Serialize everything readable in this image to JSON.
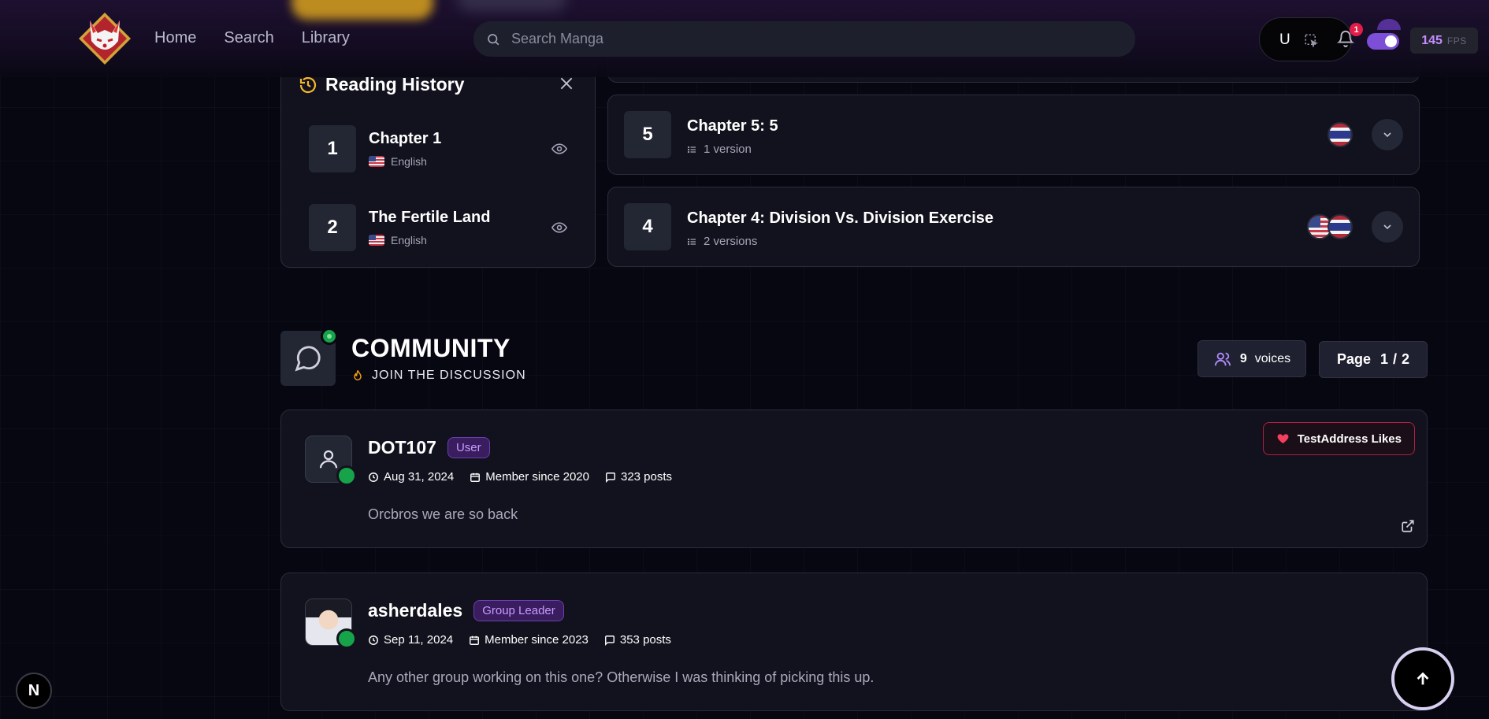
{
  "header": {
    "nav": [
      "Home",
      "Search",
      "Library"
    ],
    "search_placeholder": "Search Manga",
    "toolbar_letter": "U",
    "notification_count": "1",
    "fps_value": "145",
    "fps_label": "FPS"
  },
  "history": {
    "title": "Reading History",
    "items": [
      {
        "number": "1",
        "title": "Chapter 1",
        "language": "English"
      },
      {
        "number": "2",
        "title": "The Fertile Land",
        "language": "English"
      }
    ]
  },
  "chapters": [
    {
      "number": "5",
      "title": "Chapter 5: 5",
      "versions": "1 version"
    },
    {
      "number": "4",
      "title": "Chapter 4: Division Vs. Division Exercise",
      "versions": "2 versions"
    }
  ],
  "community": {
    "title": "COMMUNITY",
    "subtitle": "JOIN THE DISCUSSION",
    "voices_count": "9",
    "voices_label": "voices",
    "page_label": "Page",
    "page_current": "1",
    "page_sep": "/",
    "page_total": "2"
  },
  "comments": [
    {
      "username": "DOT107",
      "role": "User",
      "date": "Aug 31, 2024",
      "member_since": "Member since 2020",
      "posts": "323 posts",
      "text": "Orcbros we are so back",
      "likes": "TestAddress Likes"
    },
    {
      "username": "asherdales",
      "role": "Group Leader",
      "date": "Sep 11, 2024",
      "member_since": "Member since 2023",
      "posts": "353 posts",
      "text": "Any other group working on this one? Otherwise I was thinking of picking this up."
    }
  ],
  "misc": {
    "next_badge": "N"
  }
}
